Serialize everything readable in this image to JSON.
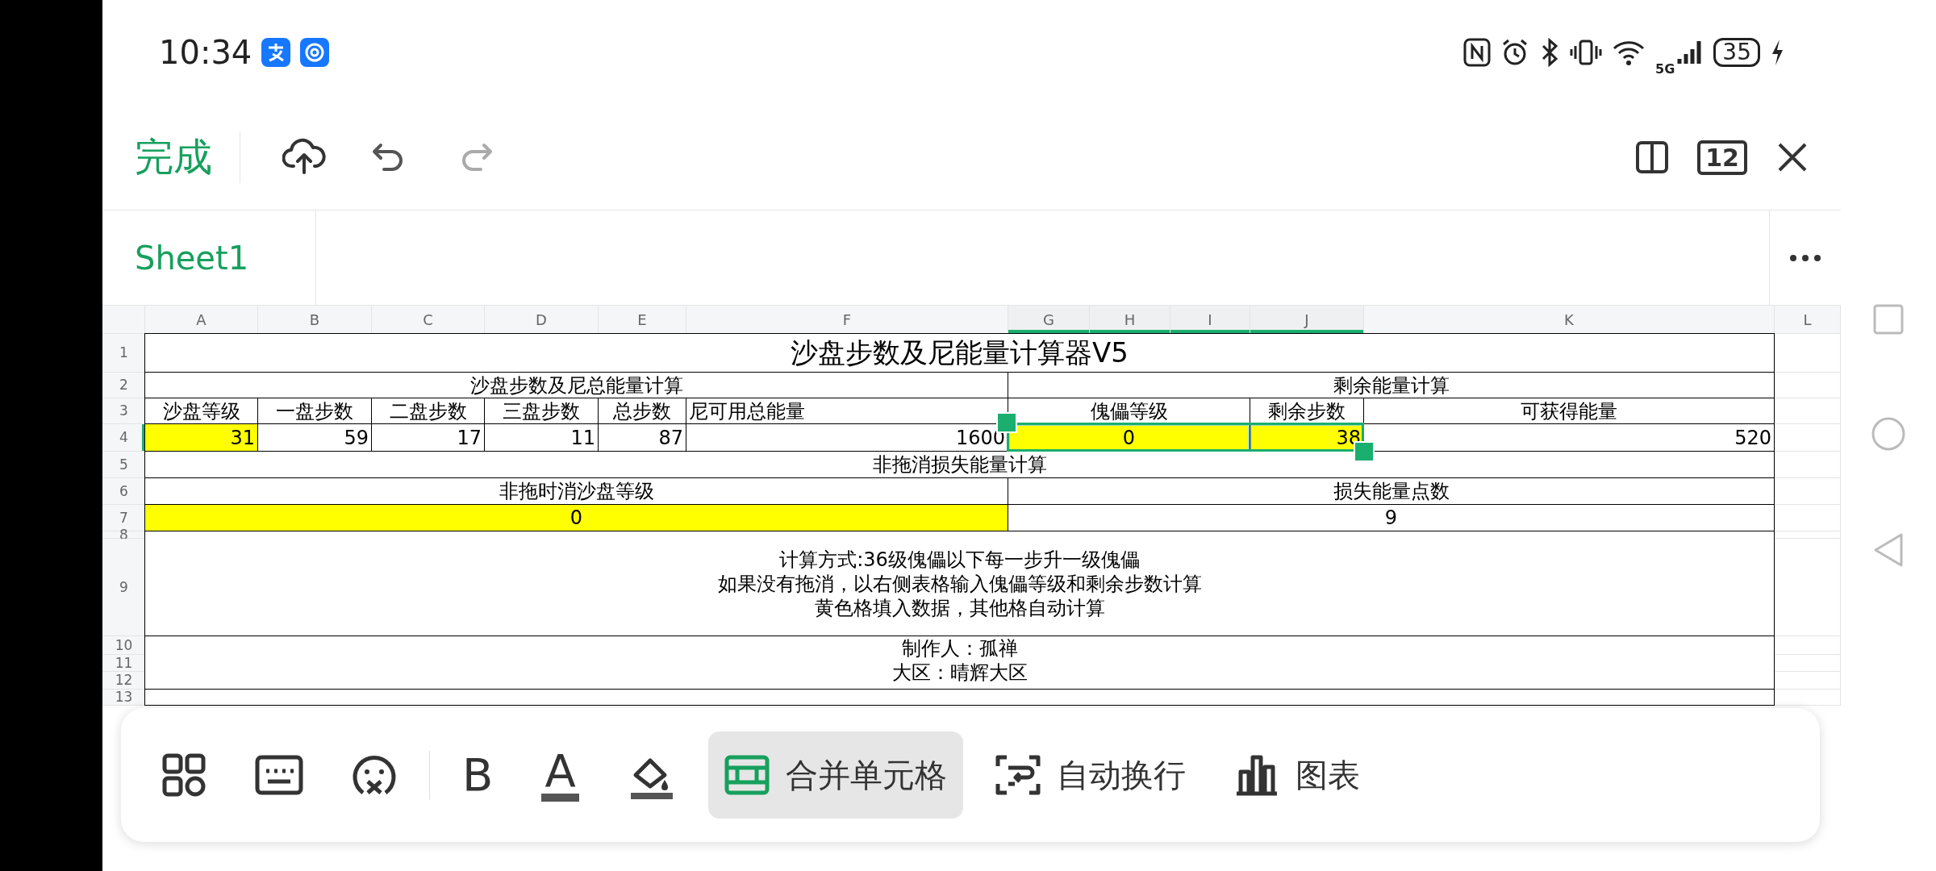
{
  "status_bar": {
    "time": "10:34",
    "network": "5G",
    "battery": "35"
  },
  "top_toolbar": {
    "done": "完成",
    "actions": [
      {
        "kind": "upload"
      },
      {
        "kind": "undo",
        "disabled": false
      },
      {
        "kind": "redo",
        "disabled": true
      }
    ],
    "sheet_count": "12"
  },
  "sheet_tabs": [
    {
      "label": "Sheet1",
      "selected": true
    }
  ],
  "sheet": {
    "columns": [
      {
        "label": "A",
        "selected": false
      },
      {
        "label": "B",
        "selected": false
      },
      {
        "label": "C",
        "selected": false
      },
      {
        "label": "D",
        "selected": false
      },
      {
        "label": "E",
        "selected": false
      },
      {
        "label": "F",
        "selected": false
      },
      {
        "label": "G",
        "selected": true
      },
      {
        "label": "H",
        "selected": true
      },
      {
        "label": "I",
        "selected": true
      },
      {
        "label": "J",
        "selected": true
      },
      {
        "label": "K",
        "selected": false
      },
      {
        "label": "L",
        "selected": false
      }
    ],
    "rows": [
      {
        "label": "1",
        "selected": false
      },
      {
        "label": "2",
        "selected": false
      },
      {
        "label": "3",
        "selected": false
      },
      {
        "label": "4",
        "selected": true
      },
      {
        "label": "5",
        "selected": false
      },
      {
        "label": "6",
        "selected": false
      },
      {
        "label": "7",
        "selected": false
      },
      {
        "label": "8",
        "selected": false
      },
      {
        "label": "9",
        "selected": false
      },
      {
        "label": "10",
        "selected": false
      },
      {
        "label": "11",
        "selected": false
      },
      {
        "label": "12",
        "selected": false
      },
      {
        "label": "13",
        "selected": false
      }
    ],
    "cells": [
      {
        "kind": "title",
        "selected": false,
        "lines": [
          "沙盘步数及尼能量计算器V5"
        ]
      },
      {
        "selected": false,
        "lines": [
          "沙盘步数及尼总能量计算"
        ]
      },
      {
        "selected": false,
        "lines": [
          "剩余能量计算"
        ]
      },
      {
        "selected": false,
        "lines": [
          "沙盘等级"
        ]
      },
      {
        "selected": false,
        "lines": [
          "一盘步数"
        ]
      },
      {
        "selected": false,
        "lines": [
          "二盘步数"
        ]
      },
      {
        "selected": false,
        "lines": [
          "三盘步数"
        ]
      },
      {
        "selected": false,
        "lines": [
          "总步数"
        ]
      },
      {
        "selected": false,
        "lines": [
          "尼可用总能量"
        ]
      },
      {
        "selected": false,
        "lines": [
          "傀儡等级"
        ]
      },
      {
        "selected": false,
        "lines": [
          "剩余步数"
        ]
      },
      {
        "selected": false,
        "lines": [
          "可获得能量"
        ]
      },
      {
        "selected": false,
        "color": "#ffff00",
        "lines": [
          "31"
        ]
      },
      {
        "selected": false,
        "lines": [
          "59"
        ]
      },
      {
        "selected": false,
        "lines": [
          "17"
        ]
      },
      {
        "selected": false,
        "lines": [
          "11"
        ]
      },
      {
        "selected": false,
        "lines": [
          "87"
        ]
      },
      {
        "selected": false,
        "lines": [
          "1600"
        ]
      },
      {
        "selected": true,
        "color": "#ffff00",
        "lines": [
          "0"
        ]
      },
      {
        "selected": true,
        "color": "#ffff00",
        "lines": [
          "38"
        ]
      },
      {
        "selected": false,
        "lines": [
          "520"
        ]
      },
      {
        "selected": false,
        "lines": [
          "非拖消损失能量计算"
        ]
      },
      {
        "selected": false,
        "lines": [
          "非拖时消沙盘等级"
        ]
      },
      {
        "selected": false,
        "lines": [
          "损失能量点数"
        ]
      },
      {
        "selected": false,
        "color": "#ffff00",
        "lines": [
          "0"
        ]
      },
      {
        "selected": false,
        "lines": [
          "9"
        ]
      },
      {
        "selected": false,
        "lines": [
          "计算方式:36级傀儡以下每一步升一级傀儡",
          "如果没有拖消，以右侧表格输入傀儡等级和剩余步数计算",
          "黄色格填入数据，其他格自动计算"
        ]
      },
      {
        "selected": false,
        "lines": [
          "制作人：孤禅",
          "大区：晴辉大区"
        ]
      }
    ]
  },
  "format_toolbar": [
    {
      "kind": "apps",
      "selected": false
    },
    {
      "kind": "keyboard",
      "selected": false
    },
    {
      "kind": "sticker",
      "selected": false
    },
    {
      "kind": "bold",
      "label": "B",
      "selected": false
    },
    {
      "kind": "font_color",
      "label": "A",
      "selected": false
    },
    {
      "kind": "fill_color",
      "selected": false
    },
    {
      "kind": "merge",
      "label": "合并单元格",
      "selected": true
    },
    {
      "kind": "wrap",
      "label": "自动换行",
      "selected": false
    },
    {
      "kind": "chart",
      "label": "图表",
      "selected": false
    }
  ]
}
